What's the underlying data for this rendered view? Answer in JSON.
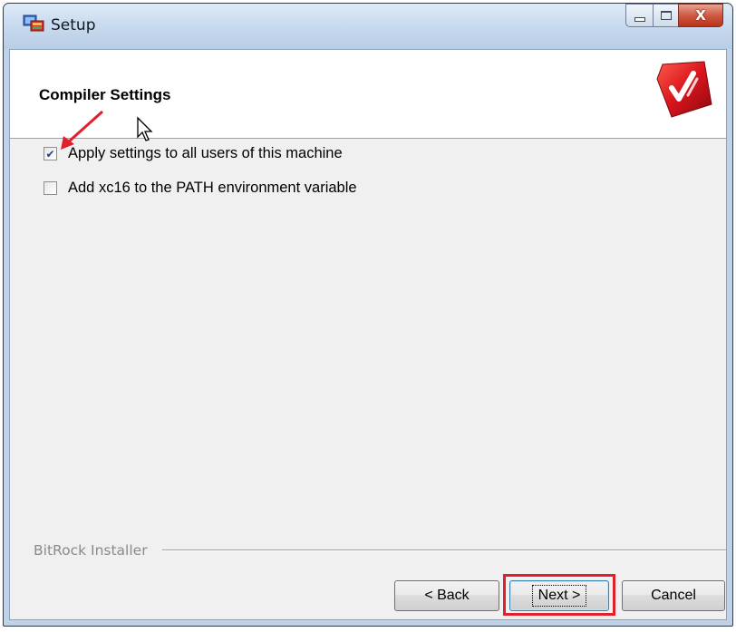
{
  "window": {
    "title": "Setup",
    "app_icon": "setup-installer-icon",
    "controls": [
      "minimize-icon",
      "maximize-icon",
      "close-icon"
    ],
    "close_glyph": "X"
  },
  "header": {
    "title": "Compiler Settings",
    "logo": "red-logo-icon"
  },
  "options": [
    {
      "label": "Apply settings to all users of this machine",
      "checked": true
    },
    {
      "label": "Add xc16 to the PATH environment variable",
      "checked": false
    }
  ],
  "footer": {
    "brand": "BitRock Installer",
    "buttons": {
      "back": "< Back",
      "next": "Next >",
      "cancel": "Cancel"
    }
  },
  "annotations": {
    "arrow_color": "#e0202a",
    "highlight_color": "#e0202a"
  }
}
